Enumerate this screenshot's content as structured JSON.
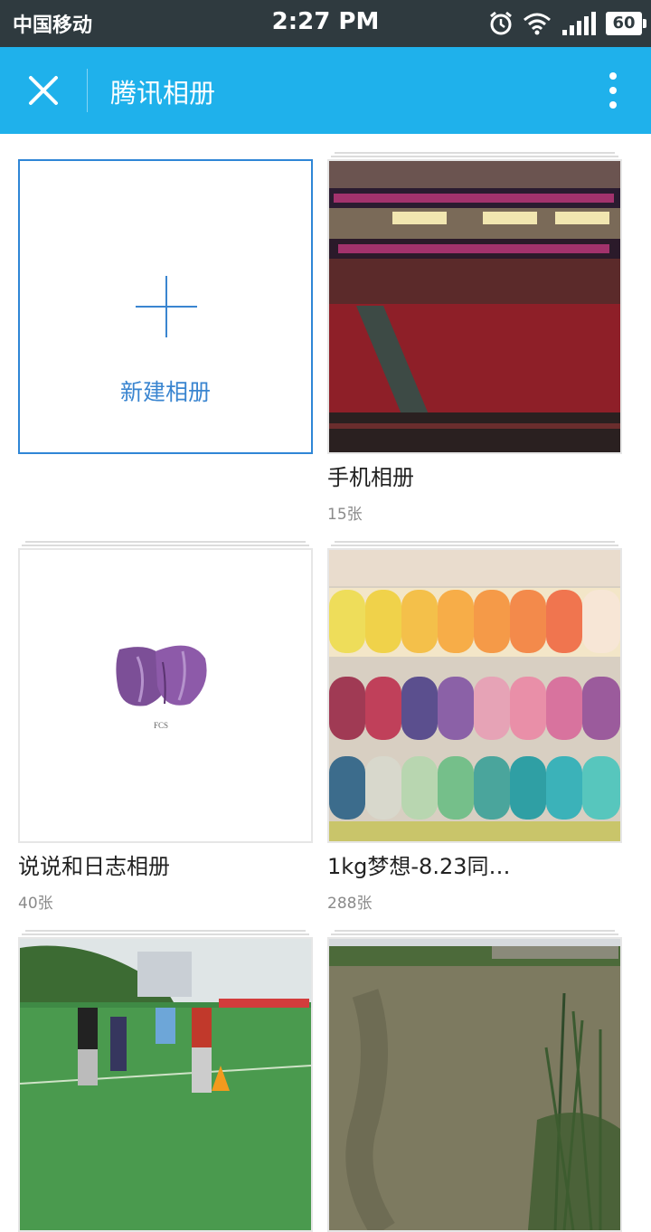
{
  "status_bar": {
    "carrier": "中国移动",
    "time": "2:27 PM",
    "battery": "60"
  },
  "app_bar": {
    "title": "腾讯相册"
  },
  "new_album": {
    "label": "新建相册"
  },
  "albums": [
    {
      "name": "手机相册",
      "count": "15张",
      "thumbnail": "stadium-seats"
    },
    {
      "name": "说说和日志相册",
      "count": "40张",
      "thumbnail": "purple-garlic-fcs",
      "thumb_caption": "FCS"
    },
    {
      "name": "1kg梦想-8.23同…",
      "count": "288张",
      "thumbnail": "color-tape-rolls"
    },
    {
      "name": "",
      "count": "",
      "thumbnail": "football-field-group"
    },
    {
      "name": "",
      "count": "",
      "thumbnail": "pond-reeds"
    }
  ],
  "colors": {
    "status_bar": "#2f3a3f",
    "app_bar": "#1fb1eb",
    "accent": "#2f86d6"
  }
}
